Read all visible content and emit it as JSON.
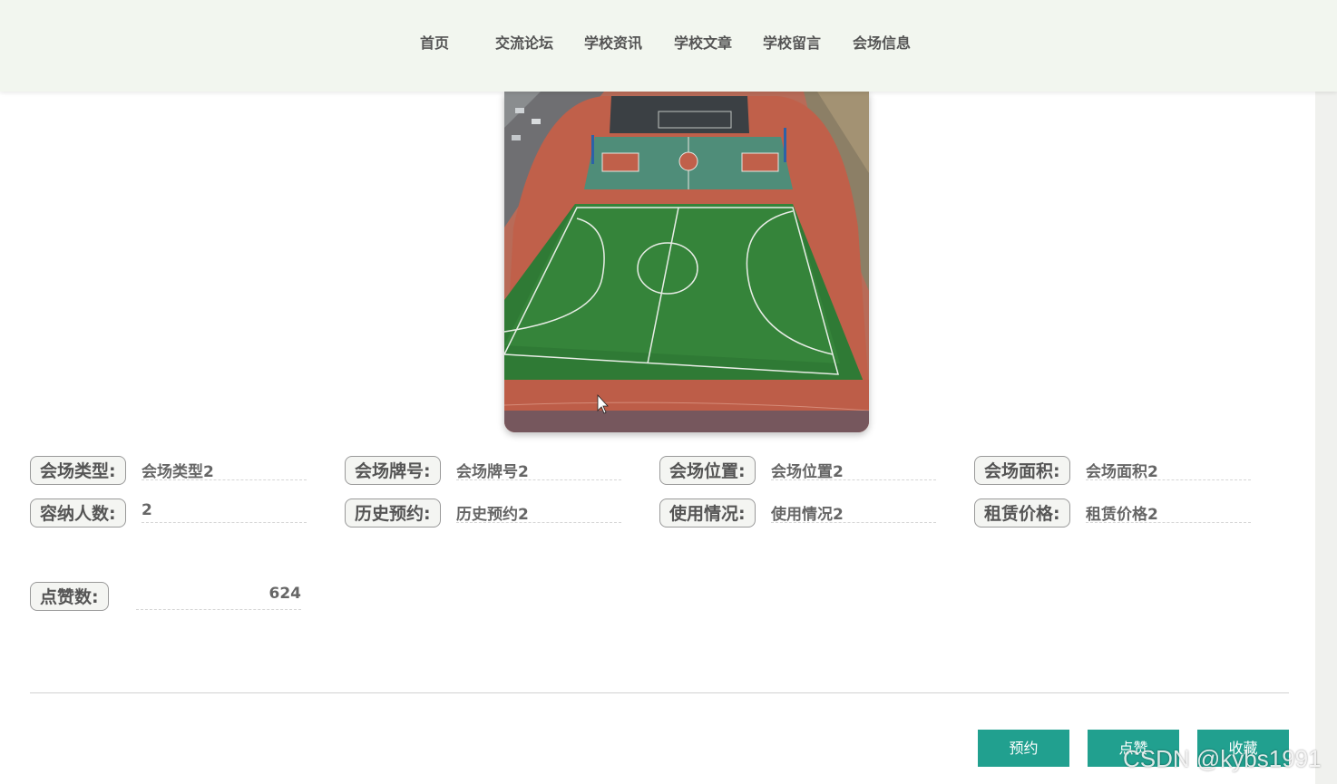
{
  "nav": {
    "items": [
      {
        "label": "首页"
      },
      {
        "label": "交流论坛"
      },
      {
        "label": "学校资讯"
      },
      {
        "label": "学校文章"
      },
      {
        "label": "学校留言"
      },
      {
        "label": "会场信息"
      }
    ]
  },
  "venue": {
    "fields": [
      {
        "label": "会场类型:",
        "value": "会场类型2"
      },
      {
        "label": "会场牌号:",
        "value": "会场牌号2"
      },
      {
        "label": "会场位置:",
        "value": "会场位置2"
      },
      {
        "label": "会场面积:",
        "value": "会场面积2"
      },
      {
        "label": "容纳人数:",
        "value": "2"
      },
      {
        "label": "历史预约:",
        "value": "历史预约2"
      },
      {
        "label": "使用情况:",
        "value": "使用情况2"
      },
      {
        "label": "租赁价格:",
        "value": "租赁价格2"
      }
    ],
    "likes": {
      "label": "点赞数:",
      "value": "624"
    }
  },
  "actions": {
    "reserve_label": "预约",
    "like_label": "点赞",
    "favorite_label": "收藏"
  },
  "colors": {
    "accent": "#21a08f",
    "nav_bg": "#f2f6ef"
  },
  "watermark": "CSDN @kybs1991"
}
